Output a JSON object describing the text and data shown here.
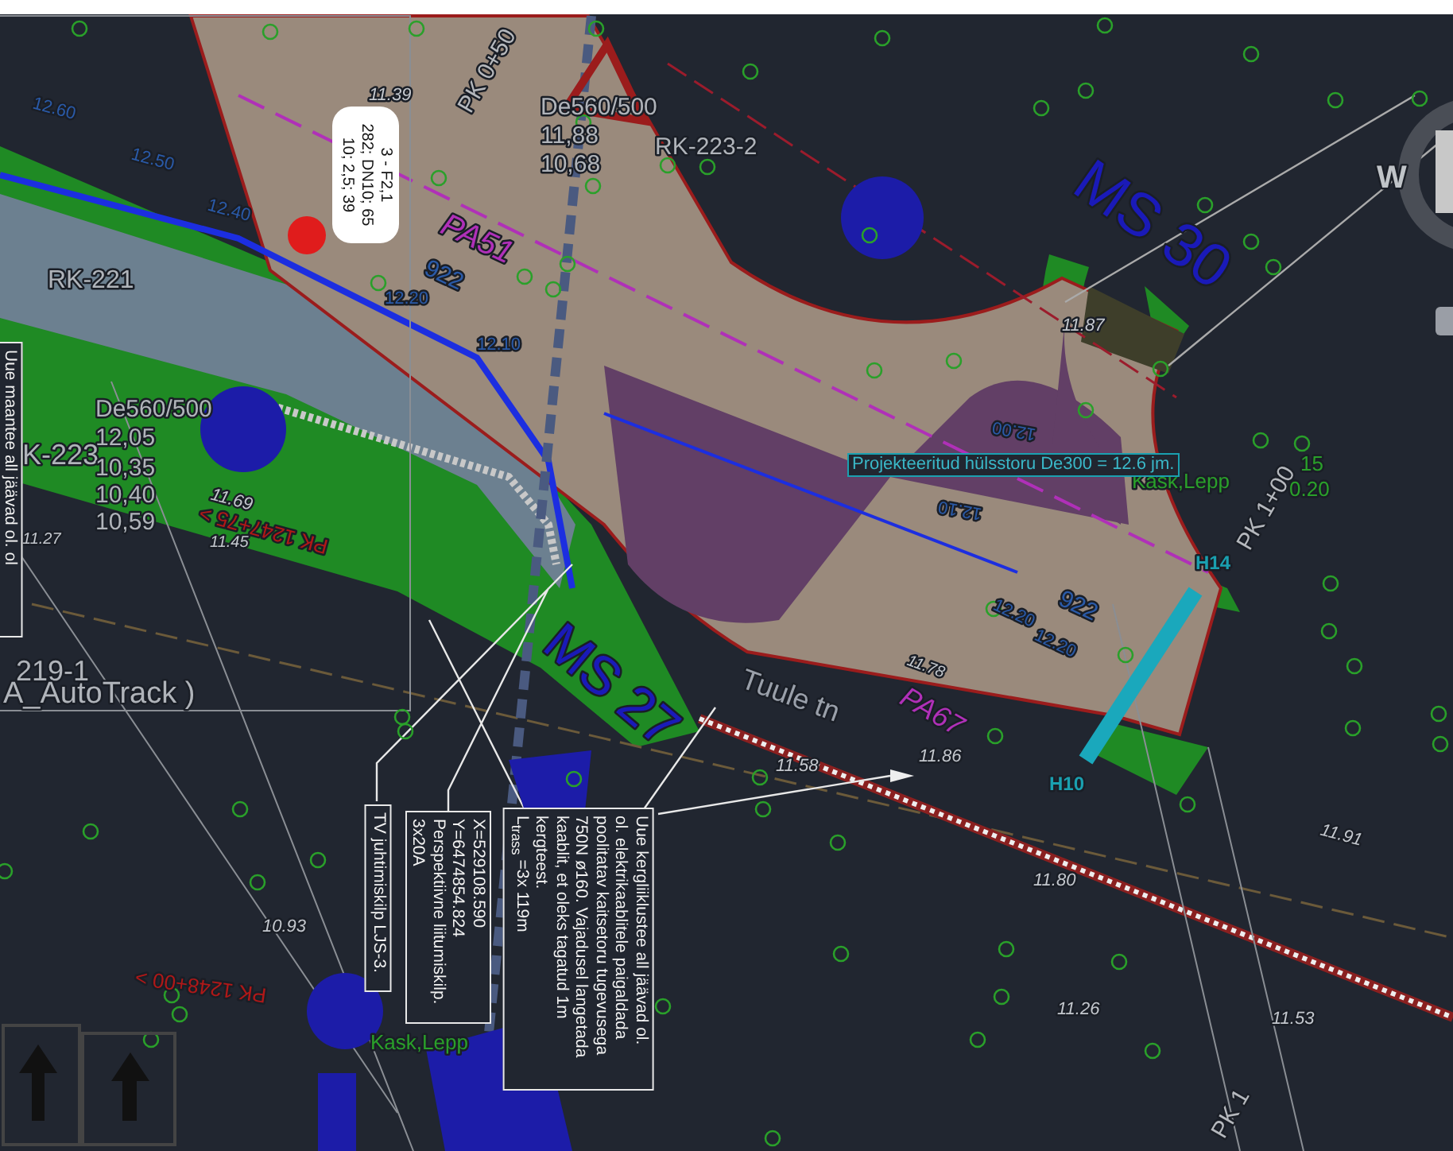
{
  "viewport": {
    "compass_label": "W",
    "labels": [
      {
        "text": "11.39",
        "kind": "elevation"
      },
      {
        "text": "PK 0+50",
        "kind": "station"
      },
      {
        "text": "De560/500",
        "kind": "label"
      },
      {
        "text": "11,88",
        "kind": "label"
      },
      {
        "text": "10,68",
        "kind": "label"
      },
      {
        "text": "RK-223-2",
        "kind": "label"
      },
      {
        "text": "12.60",
        "kind": "contour"
      },
      {
        "text": "12.50",
        "kind": "contour"
      },
      {
        "text": "12.40",
        "kind": "contour"
      },
      {
        "text": "PA51",
        "kind": "pipe"
      },
      {
        "text": "922",
        "kind": "contour"
      },
      {
        "text": "12.20",
        "kind": "contour"
      },
      {
        "text": "12.10",
        "kind": "contour"
      },
      {
        "text": "RK-221",
        "kind": "label"
      },
      {
        "text": "De560/500",
        "kind": "label"
      },
      {
        "text": "12,05",
        "kind": "label"
      },
      {
        "text": "K-223",
        "kind": "label"
      },
      {
        "text": "10,35",
        "kind": "label"
      },
      {
        "text": "10,40",
        "kind": "label"
      },
      {
        "text": "10,59",
        "kind": "label"
      },
      {
        "text": "11.69",
        "kind": "elevation"
      },
      {
        "text": "11.27",
        "kind": "elevation"
      },
      {
        "text": "11.45",
        "kind": "elevation"
      },
      {
        "text": "PK 1247+75 >",
        "kind": "chainage"
      },
      {
        "text": "219-1",
        "kind": "label"
      },
      {
        "text": "A_AutoTrack )",
        "kind": "label"
      },
      {
        "text": "MS 30",
        "kind": "zone"
      },
      {
        "text": "11.87",
        "kind": "elevation"
      },
      {
        "text": "12.00",
        "kind": "contour"
      },
      {
        "text": "Kask,Lepp",
        "kind": "tree"
      },
      {
        "text": "15",
        "kind": "tree"
      },
      {
        "text": "0.20",
        "kind": "tree"
      },
      {
        "text": "PK 1+00",
        "kind": "station"
      },
      {
        "text": "H14",
        "kind": "marker"
      },
      {
        "text": "12.10",
        "kind": "contour"
      },
      {
        "text": "12.20",
        "kind": "contour"
      },
      {
        "text": "922",
        "kind": "contour"
      },
      {
        "text": "12.20",
        "kind": "contour"
      },
      {
        "text": "11.78",
        "kind": "elevation"
      },
      {
        "text": "Tuule tn",
        "kind": "road"
      },
      {
        "text": "PA67",
        "kind": "pipe"
      },
      {
        "text": "MS 27",
        "kind": "zone"
      },
      {
        "text": "11.58",
        "kind": "elevation"
      },
      {
        "text": "11.86",
        "kind": "elevation"
      },
      {
        "text": "H10",
        "kind": "marker"
      },
      {
        "text": "11.80",
        "kind": "elevation"
      },
      {
        "text": "11.91",
        "kind": "elevation"
      },
      {
        "text": "11.26",
        "kind": "elevation"
      },
      {
        "text": "11.53",
        "kind": "elevation"
      },
      {
        "text": "10.93",
        "kind": "elevation"
      },
      {
        "text": "PK 1248+00 >",
        "kind": "chainage"
      },
      {
        "text": "Kask,Lepp",
        "kind": "tree"
      },
      {
        "text": "PK 1",
        "kind": "station"
      }
    ],
    "pipe_note": "Projekteeritud hülsstoru De300 = 12.6 jm.",
    "callouts": [
      {
        "kind": "bubble",
        "lines": [
          "3 - F2,1",
          "282; DN10; 65",
          "10; 2,5; 39"
        ]
      },
      {
        "kind": "note",
        "lines": [
          "Uue maantee all jäävad ol. ol"
        ]
      },
      {
        "kind": "note",
        "lines": [
          "TV juhtimiskilp LJS-3."
        ]
      },
      {
        "kind": "note",
        "lines": [
          "X=529108.590",
          "Y=6474854.824",
          "Perspektiivne liitumiskilp.",
          "3x20A"
        ]
      },
      {
        "kind": "note",
        "lines": [
          "Uue kergliiklustee all jäävad ol.",
          "ol. elektrikaablitele paigaldada",
          "poolitatav kaitsetoru tugevusega",
          "750N ø160. Vajadusel langetada",
          "kaablit, et oleks tagatud 1m",
          "kergteest.",
          "L$_{trass}$ =3x 119m"
        ]
      }
    ]
  }
}
